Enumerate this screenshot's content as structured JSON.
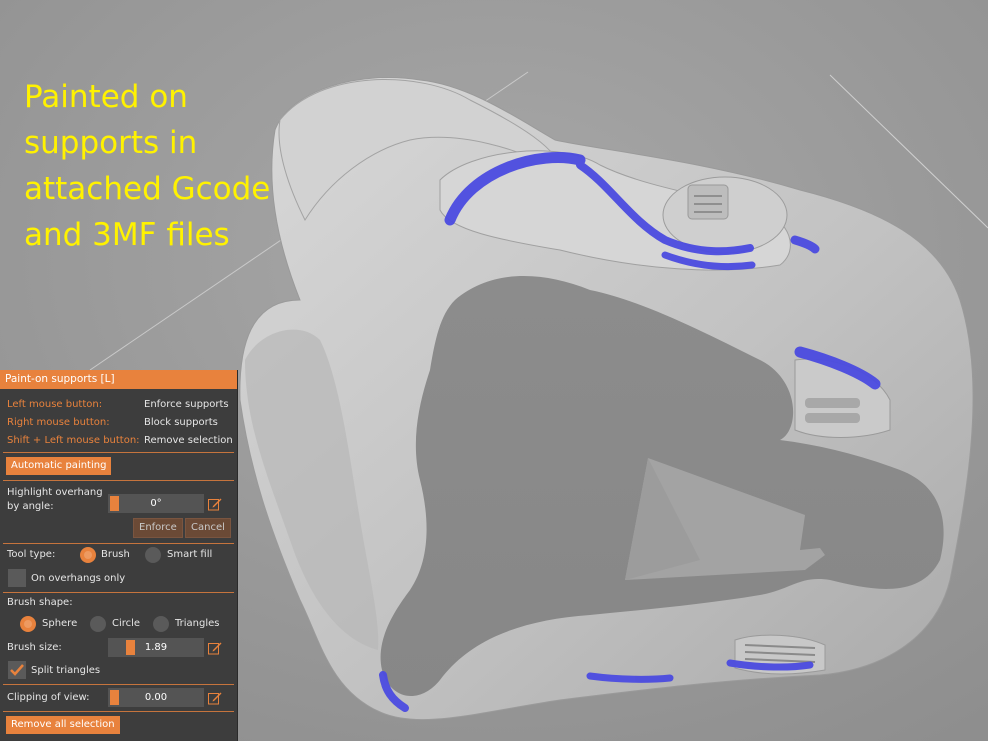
{
  "overlay": {
    "caption": "Painted on\nsupports in\nattached Gcode\nand 3MF files"
  },
  "panel": {
    "title": "Paint-on supports [L]",
    "hints": [
      {
        "key": "Left mouse button:",
        "action": "Enforce supports"
      },
      {
        "key": "Right mouse button:",
        "action": "Block supports"
      },
      {
        "key": "Shift + Left mouse button:",
        "action": "Remove selection"
      }
    ],
    "automatic_painting": "Automatic painting",
    "highlight_label_1": "Highlight overhang",
    "highlight_label_2": "by angle:",
    "highlight_value": "0°",
    "enforce": "Enforce",
    "cancel": "Cancel",
    "tool_type_label": "Tool type:",
    "tool_brush": "Brush",
    "tool_smart_fill": "Smart fill",
    "on_overhangs_only": "On overhangs only",
    "brush_shape_label": "Brush shape:",
    "shape_sphere": "Sphere",
    "shape_circle": "Circle",
    "shape_triangles": "Triangles",
    "brush_size_label": "Brush size:",
    "brush_size_value": "1.89",
    "split_triangles": "Split triangles",
    "clipping_label": "Clipping of view:",
    "clipping_value": "0.00",
    "remove_all": "Remove all selection"
  },
  "state": {
    "tool_type": "Brush",
    "brush_shape": "Sphere",
    "on_overhangs_only": false,
    "split_triangles": true
  },
  "colors": {
    "accent": "#e8823d",
    "painted_support": "#4b4be0",
    "caption": "#fff200"
  }
}
